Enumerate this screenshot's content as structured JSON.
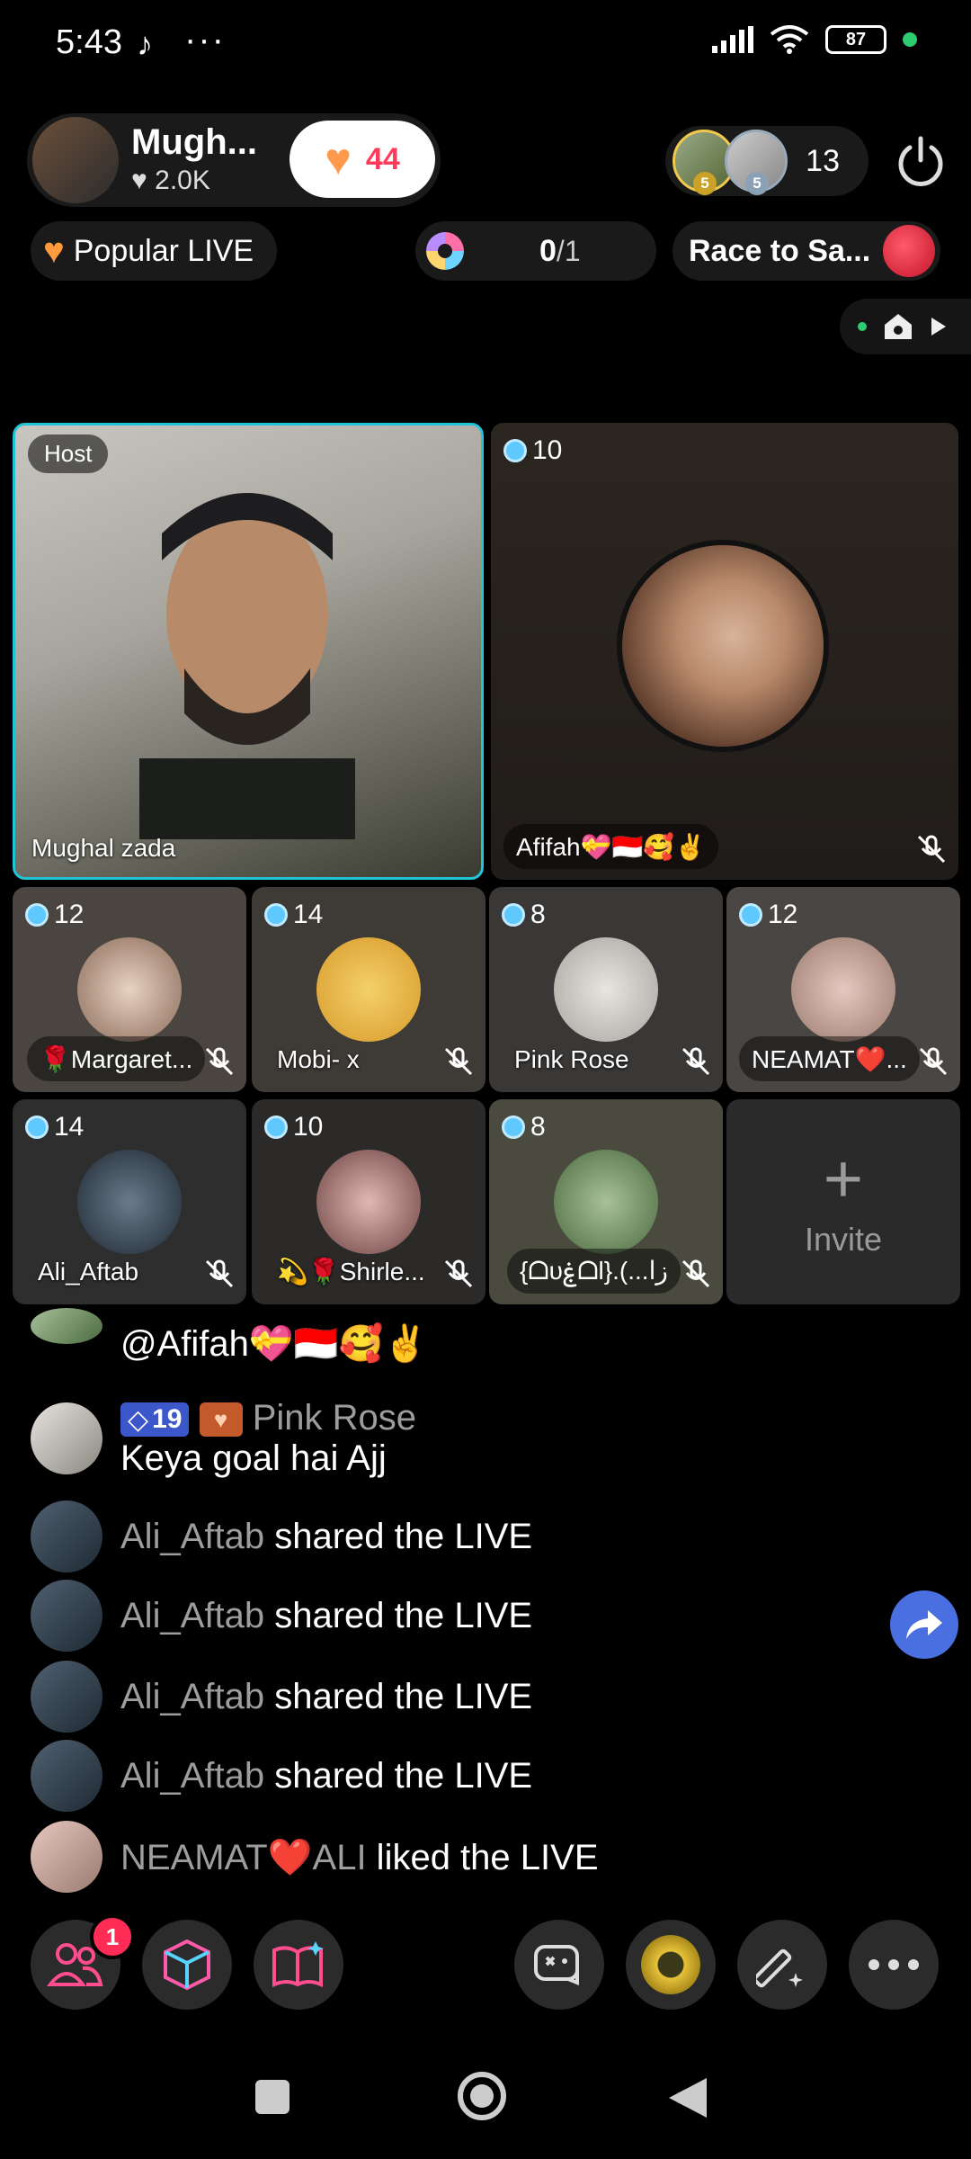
{
  "status_bar": {
    "time": "5:43",
    "battery": "87"
  },
  "host": {
    "name": "Mugh...",
    "likes": "2.0K",
    "like_count": "44"
  },
  "viewers": {
    "count": "13",
    "top1_level": "5",
    "top2_level": "5"
  },
  "chips": {
    "popular": "Popular LIVE",
    "goal_value": "0",
    "goal_total": "/1",
    "race": "Race to Sa..."
  },
  "grid": {
    "host_tag": "Host",
    "host_name": "Mughal zada",
    "big_guest": {
      "coins": "10",
      "name": "Afifah💝🇮🇩🥰✌️"
    },
    "guests": [
      {
        "coins": "12",
        "name": "🌹Margaret..."
      },
      {
        "coins": "14",
        "name": "Mobi- x"
      },
      {
        "coins": "8",
        "name": "Pink Rose"
      },
      {
        "coins": "12",
        "name": "NEAMAT❤️..."
      },
      {
        "coins": "14",
        "name": "Ali_Aftab"
      },
      {
        "coins": "10",
        "name": "💫🌹Shirle..."
      },
      {
        "coins": "8",
        "name": "{ᗝυۼᗝl}.(...زا"
      }
    ],
    "invite": "Invite"
  },
  "chat": [
    {
      "user": "",
      "text": "@Afifah💝🇮🇩🥰✌️"
    },
    {
      "level": "19",
      "user": "Pink Rose",
      "text": "Keya goal hai Ajj"
    },
    {
      "user": "Ali_Aftab",
      "text": " shared the LIVE"
    },
    {
      "user": "Ali_Aftab",
      "text": " shared the LIVE"
    },
    {
      "user": "Ali_Aftab",
      "text": " shared the LIVE"
    },
    {
      "user": "Ali_Aftab",
      "text": " shared the LIVE"
    },
    {
      "user": "NEAMAT❤️ALI",
      "text": " liked the LIVE"
    }
  ],
  "toolbar": {
    "notification_count": "1"
  },
  "icons": [
    "tiktok-icon",
    "wifi-icon",
    "signal-icon",
    "battery-icon",
    "heart-icon",
    "power-icon",
    "home-icon",
    "play-icon",
    "mic-off-icon",
    "plus-icon",
    "share-icon",
    "people-icon",
    "cube-icon",
    "book-sparkle-icon",
    "game-icon",
    "badge-icon",
    "magic-wand-icon",
    "more-icon"
  ]
}
